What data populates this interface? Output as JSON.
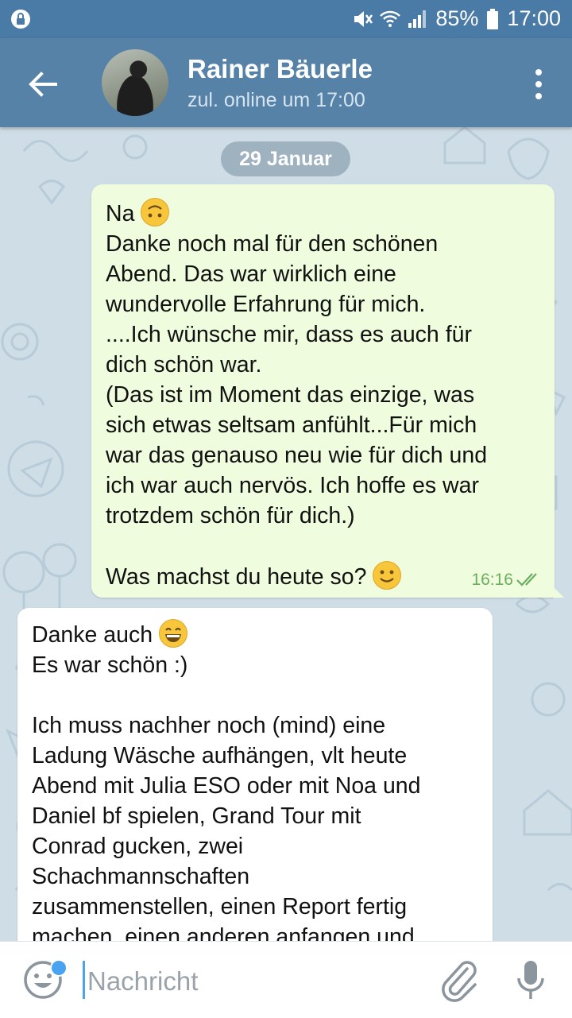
{
  "status_bar": {
    "battery": "85%",
    "time": "17:00"
  },
  "header": {
    "contact_name": "Rainer Bäuerle",
    "status": "zul. online um 17:00"
  },
  "chat": {
    "date_label": "29 Januar",
    "outgoing": {
      "line1": "Na ",
      "text": "Danke noch mal für den schönen\nAbend. Das war wirklich eine\nwundervolle Erfahrung für mich.\n....Ich wünsche mir, dass es auch für\ndich schön war.\n(Das ist im Moment das einzige, was\nsich etwas seltsam anfühlt...Für mich\nwar das genauso neu wie für dich und\nich war auch nervös. Ich hoffe es war\ntrotzdem schön für dich.)\n\n",
      "last_line": "Was machst du heute so? ",
      "time": "16:16"
    },
    "incoming": {
      "line1": "Danke auch ",
      "text": "Es war schön :)\n\nIch muss nachher noch (mind) eine\nLadung Wäsche aufhängen, vlt heute\nAbend mit Julia ESO oder mit Noa und\nDaniel bf spielen, Grand Tour mit\nConrad gucken, zwei\nSchachmannschaften\nzusammenstellen, einen Report fertig\nmachen, einen anderen anfangen und"
    }
  },
  "input": {
    "placeholder": "Nachricht"
  },
  "colors": {
    "header": "#5682a8",
    "status_bar": "#4a7aa6",
    "outgoing_bubble": "#effdde",
    "incoming_bubble": "#ffffff",
    "accent": "#4aa3f0"
  }
}
